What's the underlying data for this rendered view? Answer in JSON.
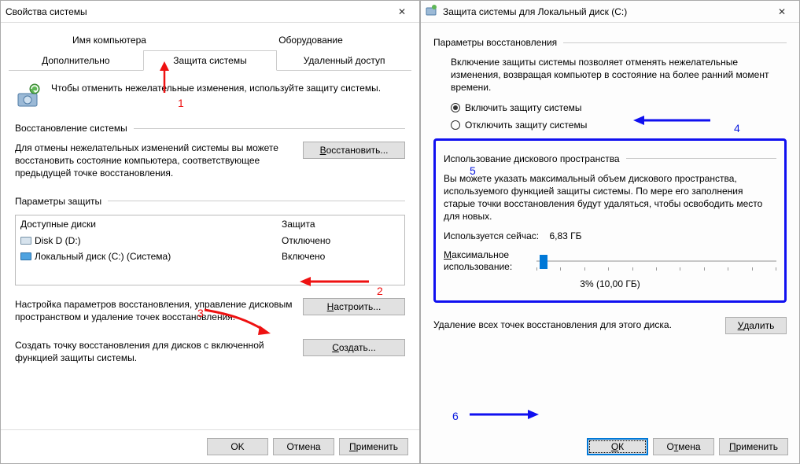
{
  "left": {
    "title": "Свойства системы",
    "tabs_r1": [
      "Имя компьютера",
      "Оборудование"
    ],
    "tabs_r2": [
      "Дополнительно",
      "Защита системы",
      "Удаленный доступ"
    ],
    "hint": "Чтобы отменить нежелательные изменения, используйте защиту системы.",
    "group_restore": "Восстановление системы",
    "restore_text": "Для отмены нежелательных изменений системы вы можете восстановить состояние компьютера, соответствующее предыдущей точке восстановления.",
    "restore_btn": "Восстановить...",
    "group_protection": "Параметры защиты",
    "col_drives": "Доступные диски",
    "col_protection": "Защита",
    "drives": [
      {
        "name": "Disk D (D:)",
        "status": "Отключено",
        "sys": false
      },
      {
        "name": "Локальный диск (C:) (Система)",
        "status": "Включено",
        "sys": true
      }
    ],
    "config_text": "Настройка параметров восстановления, управление дисковым пространством и удаление точек восстановления.",
    "config_btn": "Настроить...",
    "create_text": "Создать точку восстановления для дисков с включенной функцией защиты системы.",
    "create_btn": "Создать...",
    "ok": "OK",
    "cancel": "Отмена",
    "apply": "Применить"
  },
  "right": {
    "title": "Защита системы для Локальный диск (C:)",
    "group_params": "Параметры восстановления",
    "params_text": "Включение защиты системы позволяет отменять нежелательные изменения, возвращая компьютер в состояние на более ранний момент времени.",
    "radio_on": "Включить защиту системы",
    "radio_off": "Отключить защиту системы",
    "group_usage": "Использование дискового пространства",
    "usage_text": "Вы можете указать максимальный объем дискового пространства, используемого функцией защиты системы. По мере его заполнения старые точки восстановления будут удаляться, чтобы освободить место для новых.",
    "used_now_label": "Используется сейчас:",
    "used_now_value": "6,83 ГБ",
    "max_label": "Максимальное использование:",
    "pct_label": "3% (10,00 ГБ)",
    "delete_text": "Удаление всех точек восстановления для этого диска.",
    "delete_btn": "Удалить",
    "ok": "OK",
    "cancel": "Отмена",
    "apply": "Применить"
  },
  "annotations": {
    "n1": "1",
    "n2": "2",
    "n3": "3",
    "n4": "4",
    "n5": "5",
    "n6": "6"
  }
}
